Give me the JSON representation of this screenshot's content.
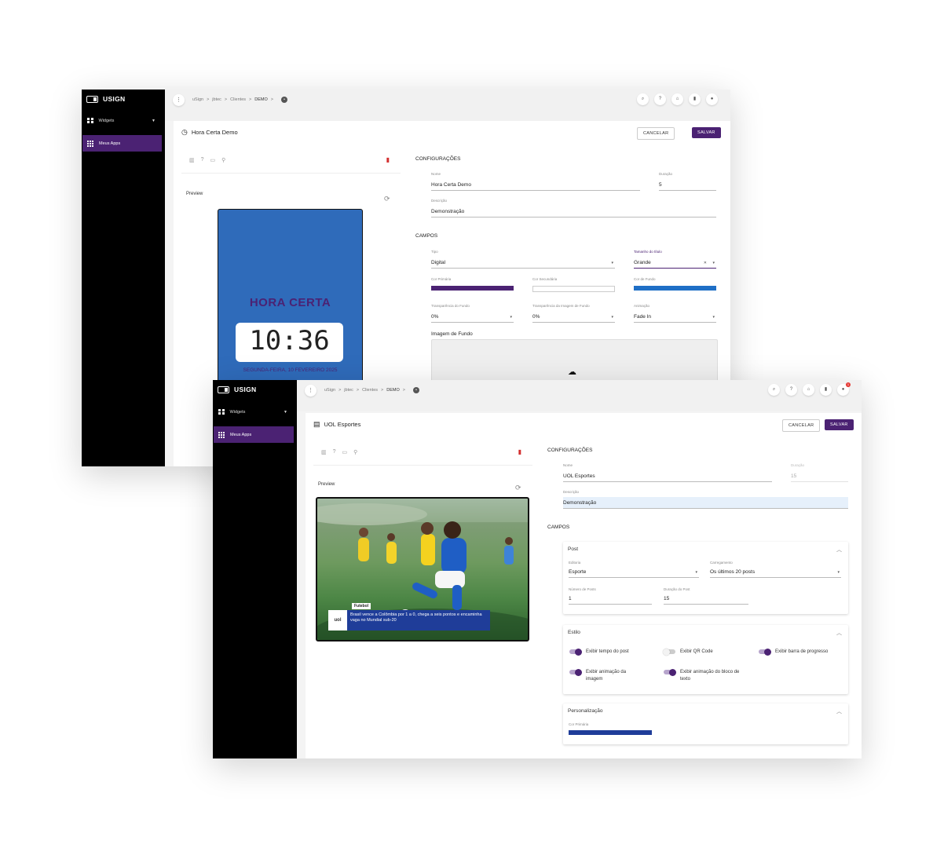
{
  "window1": {
    "brand": "USIGN",
    "sidebar": {
      "widgets": "Widgets",
      "my_apps": "Meus Apps"
    },
    "breadcrumb": [
      "uSign",
      ">",
      "jbtec",
      ">",
      "Clientes",
      ">",
      "DEMO",
      ">"
    ],
    "page_title": "Hora Certa Demo",
    "cancel": "CANCELAR",
    "save": "SALVAR",
    "preview_label": "Preview",
    "preview": {
      "title": "HORA CERTA",
      "time": "10:36",
      "date": "SEGUNDA-FEIRA, 10 FEVEREIRO 2025"
    },
    "config_heading": "CONFIGURAÇÕES",
    "nome_label": "Nome",
    "nome_value": "Hora Certa Demo",
    "duracao_label": "Duração",
    "duracao_value": "5",
    "descricao_label": "Descrição",
    "descricao_value": "Demonstração",
    "campos_heading": "CAMPOS",
    "tipo_label": "Tipo",
    "tipo_value": "Digital",
    "tamanho_label": "Tamanho do título",
    "tamanho_value": "Grande",
    "cor_primaria_label": "Cor Primária",
    "cor_secundaria_label": "Cor Secundária",
    "cor_fundo_label": "Cor de Fundo",
    "transp_fundo_label": "Transparência do Fundo",
    "transp_fundo_value": "0%",
    "transp_imagem_label": "Transparência da Imagem de Fundo",
    "transp_imagem_value": "0%",
    "animacao_label": "Animação",
    "animacao_value": "Fade In",
    "imagem_fundo_label": "Imagem de Fundo"
  },
  "window2": {
    "brand": "USIGN",
    "sidebar": {
      "widgets": "Widgets",
      "my_apps": "Meus Apps"
    },
    "breadcrumb": [
      "uSign",
      ">",
      "jbtec",
      ">",
      "Clientes",
      ">",
      "DEMO",
      ">"
    ],
    "notification_count": "1",
    "page_title": "UOL Esportes",
    "cancel": "CANCELAR",
    "save": "SALVAR",
    "preview_label": "Preview",
    "preview": {
      "tag": "Futebol",
      "logo": "uol",
      "headline": "Brasil vence a Colômbia por 1 a 0, chega a seis pontos e encaminha vaga no Mundial sub-20"
    },
    "config_heading": "CONFIGURAÇÕES",
    "nome_label": "Nome",
    "nome_value": "UOL Esportes",
    "duracao_label": "Duração",
    "duracao_value": "15",
    "descricao_label": "Descrição",
    "descricao_value": "Demonstração",
    "campos_heading": "CAMPOS",
    "post": {
      "title": "Post",
      "editoria_label": "Editoria",
      "editoria_value": "Esporte",
      "carregamento_label": "Carregamento",
      "carregamento_value": "Os últimos 20 posts",
      "numero_label": "Número de Posts",
      "numero_value": "1",
      "duracao_post_label": "Duração do Post",
      "duracao_post_value": "15"
    },
    "estilo": {
      "title": "Estilo",
      "t1": "Exibir tempo do post",
      "t2": "Exibir QR Code",
      "t3": "Exibir barra de progresso",
      "t4": "Exibir animação da imagem",
      "t5": "Exibir animação do bloco de texto"
    },
    "personalizacao": {
      "title": "Personalização",
      "cor_primaria_label": "Cor Primária"
    }
  },
  "colors": {
    "accent": "#4b2273",
    "preview_bg": "#2f6bba",
    "cor_fundo": "#1f6fc6",
    "personalizacao_cor": "#1f3d99",
    "delete": "#d32f2f"
  },
  "toggles_state": {
    "t1": true,
    "t2": false,
    "t3": true,
    "t4": true,
    "t5": true
  },
  "icons": [
    "menu-dots-icon",
    "search-icon",
    "help-icon",
    "home-icon",
    "trash-icon",
    "bell-icon",
    "clock-icon",
    "newspaper-icon",
    "chart-icon",
    "video-icon",
    "location-icon",
    "rotate-icon",
    "upload-cloud-icon",
    "chevron-up-icon",
    "close-icon"
  ]
}
